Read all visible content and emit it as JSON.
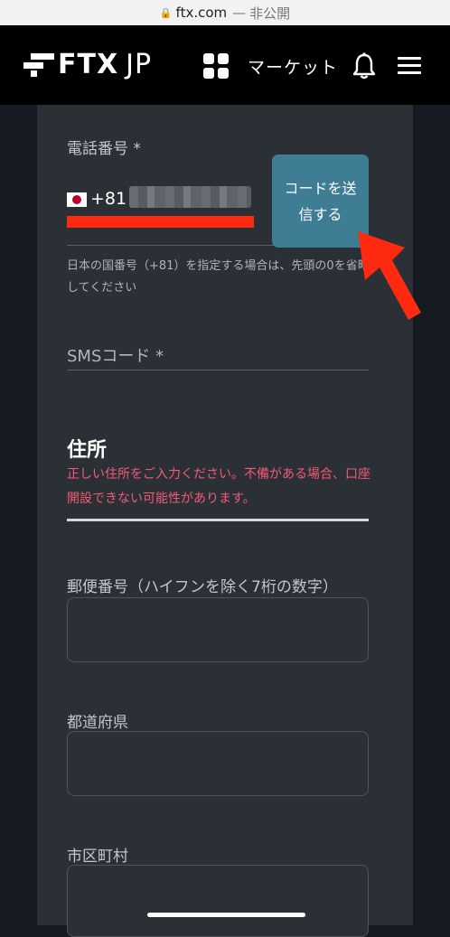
{
  "browser": {
    "url": "ftx.com",
    "separator": "—",
    "privacy": "非公開"
  },
  "header": {
    "logo_main": "FTX",
    "logo_sub": "JP",
    "market": "マーケット"
  },
  "phone": {
    "label": "電話番号 *",
    "country_code": "+81",
    "send_button": "コードを送信する",
    "hint": "日本の国番号（+81）を指定する場合は、先頭の0を省略してください"
  },
  "sms": {
    "label": "SMSコード *"
  },
  "address": {
    "title": "住所",
    "warning": "正しい住所をご入力ください。不備がある場合、口座開設できない可能性があります。",
    "postal_label": "郵便番号（ハイフンを除く7桁の数字）",
    "prefecture_label": "都道府県",
    "city_label": "市区町村"
  },
  "colors": {
    "accent_button": "#3e7d93",
    "warning_text": "#f35a73",
    "highlight": "#ff2a10"
  }
}
